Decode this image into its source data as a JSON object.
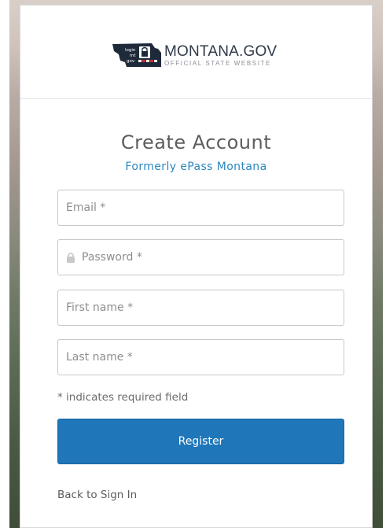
{
  "logo": {
    "title": "MONTANA.GOV",
    "subtitle": "OFFICIAL STATE WEBSITE",
    "mark_text": [
      "login",
      "mt",
      "gov"
    ]
  },
  "form": {
    "title": "Create Account",
    "subtitle": "Formerly ePass Montana",
    "email_placeholder": "Email *",
    "password_placeholder": "Password *",
    "first_name_placeholder": "First name *",
    "last_name_placeholder": "Last name *",
    "required_note": "* indicates required field",
    "register_label": "Register",
    "back_label": "Back to Sign In"
  },
  "colors": {
    "accent": "#1f76b8",
    "subtitle": "#2a86bf",
    "logo_dark": "#1e2a3a"
  },
  "icons": {
    "lock": "lock-icon"
  }
}
